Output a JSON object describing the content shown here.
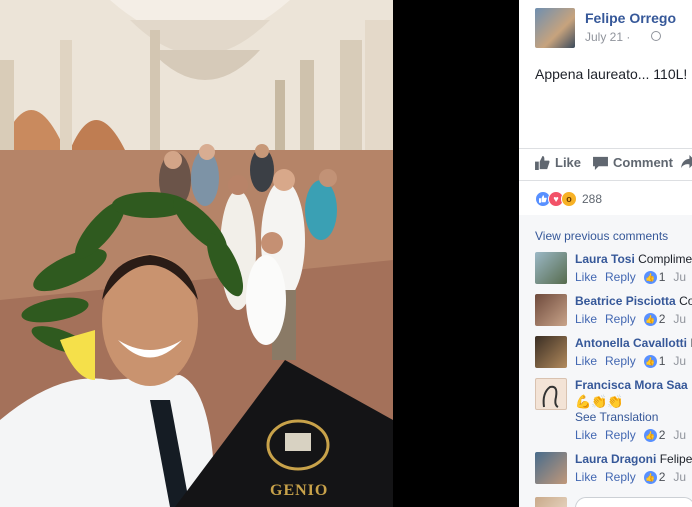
{
  "photo": {
    "folder_text": "GENIO",
    "description_icon": "graduation-selfie-photo"
  },
  "post": {
    "author_name": "Felipe Orrego",
    "date": "July 21 · ",
    "privacy_icon": "globe-icon",
    "text": "Appena laureato... 110L!"
  },
  "actions": {
    "like_label": "Like",
    "comment_label": "Comment"
  },
  "reactions": {
    "icons": [
      "like-reaction-icon",
      "love-reaction-icon",
      "wow-reaction-icon"
    ],
    "count": "288"
  },
  "comments": {
    "view_previous": "View previous comments",
    "items": [
      {
        "name": "Laura Tosi",
        "text": "Complime",
        "like": "Like",
        "reply": "Reply",
        "likes": "1",
        "time": "Ju"
      },
      {
        "name": "Beatrice Pisciotta",
        "text": "Co",
        "like": "Like",
        "reply": "Reply",
        "likes": "2",
        "time": "Ju"
      },
      {
        "name": "Antonella Cavallotti",
        "text": "I",
        "like": "Like",
        "reply": "Reply",
        "likes": "1",
        "time": "Ju"
      },
      {
        "name": "Francisca Mora Saa",
        "text": "",
        "emoji": "💪👏👏",
        "see_translation": "See Translation",
        "like": "Like",
        "reply": "Reply",
        "likes": "2",
        "time": "Ju"
      },
      {
        "name": "Laura Dragoni",
        "text": "Felipe",
        "like": "Like",
        "reply": "Reply",
        "likes": "2",
        "time": "Ju"
      }
    ]
  },
  "colors": {
    "link_blue": "#365899",
    "action_gray": "#606770",
    "like_blue": "#5890ff",
    "love_red": "#f25268",
    "wow_yellow": "#f7b125"
  }
}
